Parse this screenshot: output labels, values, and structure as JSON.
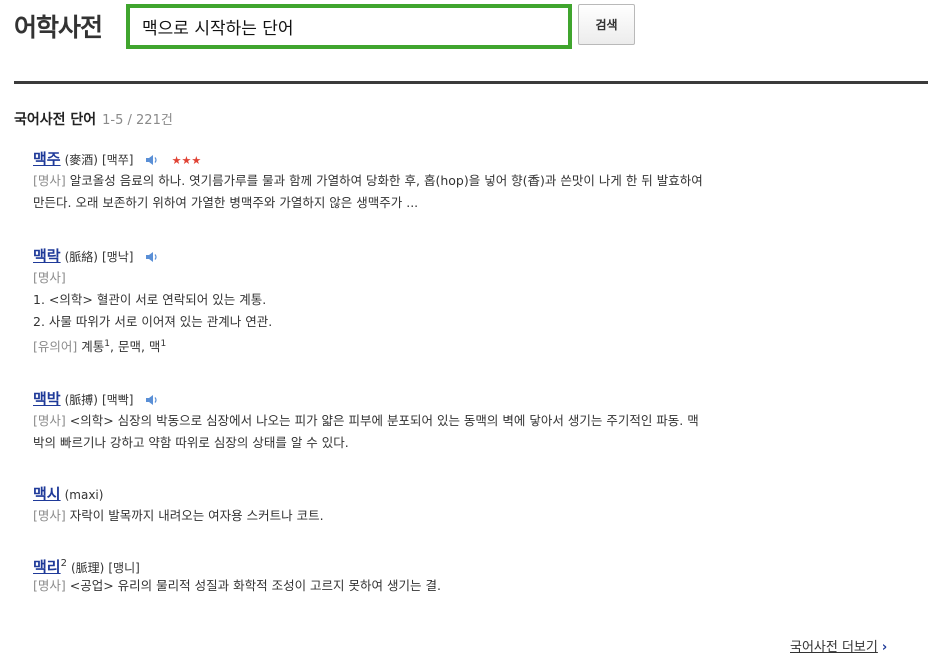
{
  "header": {
    "logo": "어학사전",
    "search_value": "맥으로 시작하는 단어",
    "search_button": "검색"
  },
  "section": {
    "title": "국어사전 단어",
    "range": "1-5 / 221건"
  },
  "entries": [
    {
      "word": "맥주",
      "hanja": "(麥酒)",
      "pron": "[맥쭈]",
      "stars": "★★★",
      "lines": [
        {
          "pos": "[명사]",
          "text": "알코올성 음료의 하나. 엿기름가루를 물과 함께 가열하여 당화한 후, 홉(hop)을 넣어 향(香)과 쓴맛이 나게 한 뒤 발효하여"
        },
        {
          "pos": "",
          "text": "만든다. 오래 보존하기 위하여 가열한 병맥주와 가열하지 않은 생맥주가 ..."
        }
      ]
    },
    {
      "word": "맥락",
      "hanja": "(脈絡)",
      "pron": "[맹낙]",
      "lines": [
        {
          "pos": "[명사]",
          "text": ""
        },
        {
          "pos": "",
          "text": "1. <의학> 혈관이 서로 연락되어 있는 계통."
        },
        {
          "pos": "",
          "text": "2. 사물 따위가 서로 이어져 있는 관계나 연관."
        }
      ],
      "synonym_label": "[유의어]",
      "synonyms": [
        "계통",
        "문맥",
        "맥"
      ],
      "synonym_sups": [
        "1",
        "1"
      ]
    },
    {
      "word": "맥박",
      "hanja": "(脈搏)",
      "pron": "[맥빡]",
      "lines": [
        {
          "pos": "[명사]",
          "text": "<의학> 심장의 박동으로 심장에서 나오는 피가 얇은 피부에 분포되어 있는 동맥의 벽에 닿아서 생기는 주기적인 파동. 맥"
        },
        {
          "pos": "",
          "text": "박의 빠르기나 강하고 약함 따위로 심장의 상태를 알 수 있다."
        }
      ]
    },
    {
      "word": "맥시",
      "hanja": "(maxi)",
      "lines": [
        {
          "pos": "[명사]",
          "text": "자락이 발목까지 내려오는 여자용 스커트나 코트."
        }
      ]
    },
    {
      "word": "맥리",
      "word_sup": "2",
      "hanja": "(脈理)",
      "pron": "[맹니]",
      "lines": [
        {
          "pos": "[명사]",
          "text": "<공업> 유리의 물리적 성질과 화학적 조성이 고르지 못하여 생기는 결."
        }
      ]
    }
  ],
  "footer": {
    "more_link": "국어사전 더보기",
    "more_arrow": "›"
  },
  "icons": {
    "speaker": "speaker-icon",
    "star": "star-icon",
    "arrow": "chevron-right-icon"
  },
  "colors": {
    "search_border": "#40a52e",
    "link": "#1f3a99",
    "stars": "#e04334",
    "divider": "#3b3b3b"
  }
}
